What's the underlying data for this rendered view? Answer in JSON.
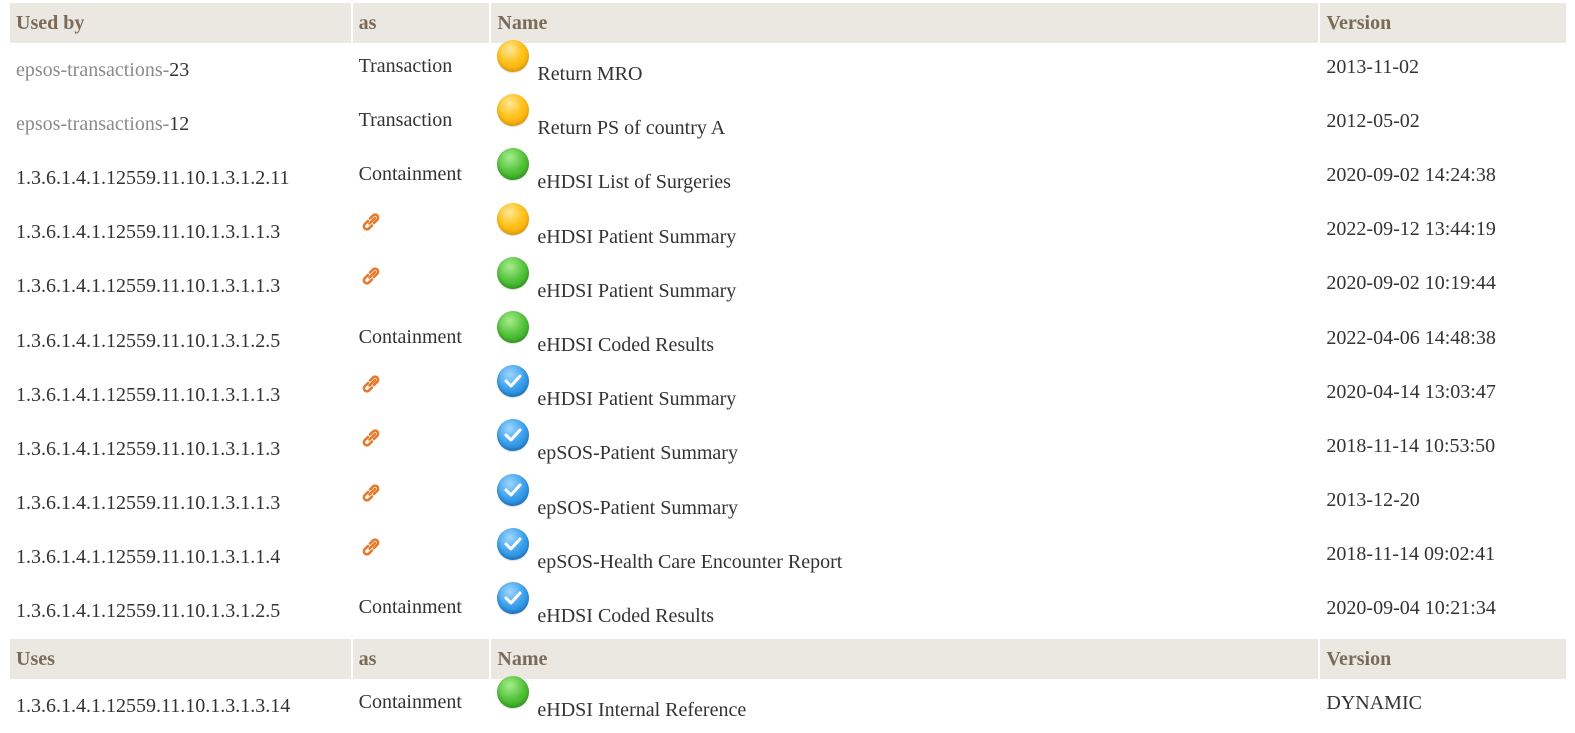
{
  "used_by_section": {
    "headers": {
      "oid": "Used by",
      "as": "as",
      "name": "Name",
      "version": "Version"
    },
    "rows": [
      {
        "oid_prefix": "epsos-transactions-",
        "oid": "23",
        "as": "Transaction",
        "status": "draft",
        "status_icon": "status-draft-icon",
        "name": "Return MRO",
        "version": "2013-11-02"
      },
      {
        "oid_prefix": "epsos-transactions-",
        "oid": "12",
        "as": "Transaction",
        "status": "draft",
        "status_icon": "status-draft-icon",
        "name": "Return PS of country A",
        "version": "2012-05-02"
      },
      {
        "oid_prefix": "",
        "oid": "1.3.6.1.4.1.12559.11.10.1.3.1.2.11",
        "as": "Containment",
        "status": "active",
        "status_icon": "status-active-icon",
        "name": "eHDSI List of Surgeries",
        "version": "2020-09-02 14:24:38"
      },
      {
        "oid_prefix": "",
        "oid": "1.3.6.1.4.1.12559.11.10.1.3.1.1.3",
        "as": "",
        "as_icon": "link-icon",
        "status": "draft",
        "status_icon": "status-draft-icon",
        "name": "eHDSI Patient Summary",
        "version": "2022-09-12 13:44:19"
      },
      {
        "oid_prefix": "",
        "oid": "1.3.6.1.4.1.12559.11.10.1.3.1.1.3",
        "as": "",
        "as_icon": "link-icon",
        "status": "active",
        "status_icon": "status-active-icon",
        "name": "eHDSI Patient Summary",
        "version": "2020-09-02 10:19:44"
      },
      {
        "oid_prefix": "",
        "oid": "1.3.6.1.4.1.12559.11.10.1.3.1.2.5",
        "as": "Containment",
        "status": "active",
        "status_icon": "status-active-icon",
        "name": "eHDSI Coded Results",
        "version": "2022-04-06 14:48:38"
      },
      {
        "oid_prefix": "",
        "oid": "1.3.6.1.4.1.12559.11.10.1.3.1.1.3",
        "as": "",
        "as_icon": "link-icon",
        "status": "final",
        "status_icon": "status-final-icon",
        "name": "eHDSI Patient Summary",
        "version": "2020-04-14 13:03:47"
      },
      {
        "oid_prefix": "",
        "oid": "1.3.6.1.4.1.12559.11.10.1.3.1.1.3",
        "as": "",
        "as_icon": "link-icon",
        "status": "final",
        "status_icon": "status-final-icon",
        "name": "epSOS-Patient Summary",
        "version": "2018-11-14 10:53:50"
      },
      {
        "oid_prefix": "",
        "oid": "1.3.6.1.4.1.12559.11.10.1.3.1.1.3",
        "as": "",
        "as_icon": "link-icon",
        "status": "final",
        "status_icon": "status-final-icon",
        "name": "epSOS-Patient Summary",
        "version": "2013-12-20"
      },
      {
        "oid_prefix": "",
        "oid": "1.3.6.1.4.1.12559.11.10.1.3.1.1.4",
        "as": "",
        "as_icon": "link-icon",
        "status": "final",
        "status_icon": "status-final-icon",
        "name": "epSOS-Health Care Encounter Report",
        "version": "2018-11-14 09:02:41"
      },
      {
        "oid_prefix": "",
        "oid": "1.3.6.1.4.1.12559.11.10.1.3.1.2.5",
        "as": "Containment",
        "status": "final",
        "status_icon": "status-final-icon",
        "name": "eHDSI Coded Results",
        "version": "2020-09-04 10:21:34"
      }
    ]
  },
  "uses_section": {
    "headers": {
      "oid": "Uses",
      "as": "as",
      "name": "Name",
      "version": "Version"
    },
    "rows": [
      {
        "oid_prefix": "",
        "oid": "1.3.6.1.4.1.12559.11.10.1.3.1.3.14",
        "as": "Containment",
        "status": "active",
        "status_icon": "status-active-icon",
        "name": "eHDSI Internal Reference",
        "version": "DYNAMIC"
      }
    ]
  },
  "colors": {
    "header_bg": "#ebe7e1",
    "header_text": "#7a6a58",
    "prefix_text": "#8a8a8a",
    "body_text": "#333333",
    "link_icon": "#e8782a",
    "draft": "#ffc21a",
    "active": "#52c23a",
    "final": "#3aa0ec"
  }
}
